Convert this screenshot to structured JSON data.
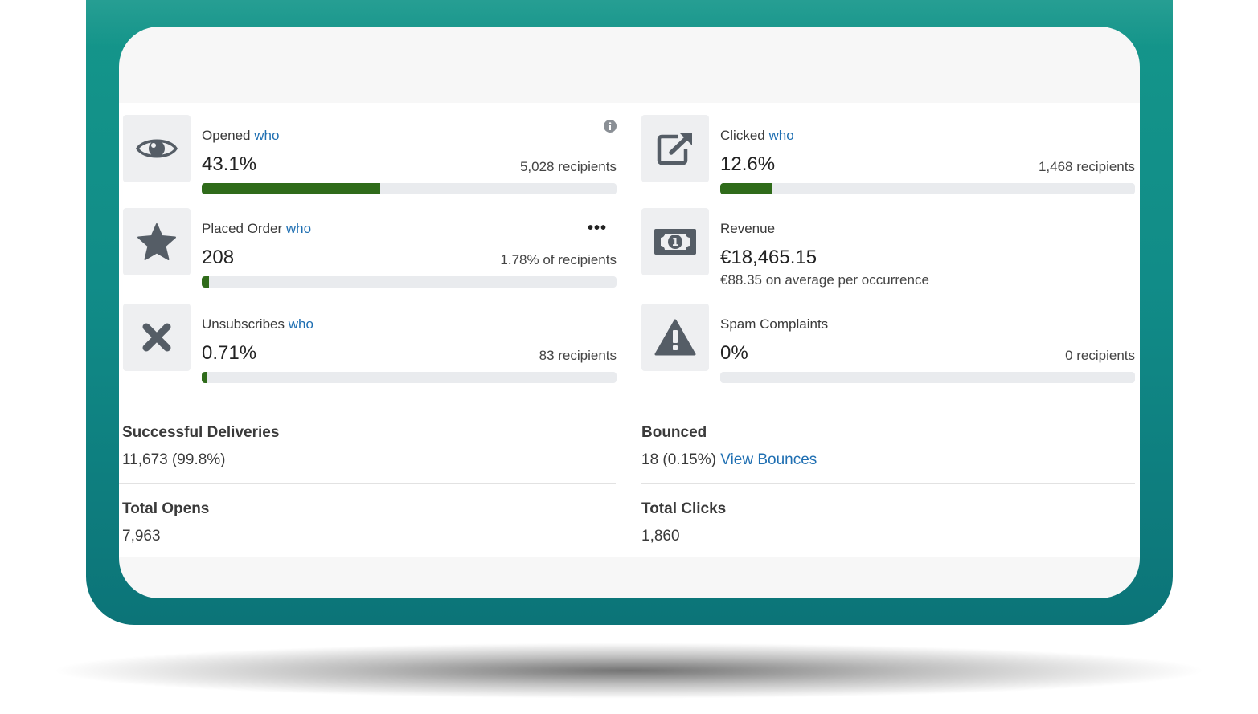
{
  "colors": {
    "frame": "#118c88",
    "card_bg": "#f7f7f7",
    "panel_bg": "#ffffff",
    "bar_track": "#e9ebee",
    "bar_fill": "#2f6b1a",
    "link": "#1f6fb2",
    "icon_tile": "#eeeff1"
  },
  "metrics": {
    "opened": {
      "label": "Opened",
      "who": "who",
      "value": "43.1%",
      "sub": "5,028 recipients",
      "progress_percent": 43.1,
      "icon": "eye-icon",
      "extra_icon": "info-icon"
    },
    "clicked": {
      "label": "Clicked",
      "who": "who",
      "value": "12.6%",
      "sub": "1,468 recipients",
      "progress_percent": 12.6,
      "icon": "external-link-icon"
    },
    "placed_order": {
      "label": "Placed Order",
      "who": "who",
      "value": "208",
      "sub": "1.78% of recipients",
      "progress_percent": 1.78,
      "icon": "star-icon",
      "extra_icon": "more-icon",
      "more": "•••"
    },
    "revenue": {
      "label": "Revenue",
      "value": "€18,465.15",
      "sub": "€88.35 on average per occurrence",
      "icon": "money-bill-icon"
    },
    "unsubscribes": {
      "label": "Unsubscribes",
      "who": "who",
      "value": "0.71%",
      "sub": "83 recipients",
      "progress_percent": 0.71,
      "icon": "x-icon"
    },
    "spam": {
      "label": "Spam Complaints",
      "value": "0%",
      "sub": "0 recipients",
      "progress_percent": 0,
      "icon": "warning-icon"
    }
  },
  "stats": {
    "successful_deliveries": {
      "label": "Successful Deliveries",
      "value": "11,673 (99.8%)"
    },
    "bounced": {
      "label": "Bounced",
      "value": "18 (0.15%)",
      "link": "View Bounces"
    },
    "total_opens": {
      "label": "Total Opens",
      "value": "7,963"
    },
    "total_clicks": {
      "label": "Total Clicks",
      "value": "1,860"
    }
  }
}
